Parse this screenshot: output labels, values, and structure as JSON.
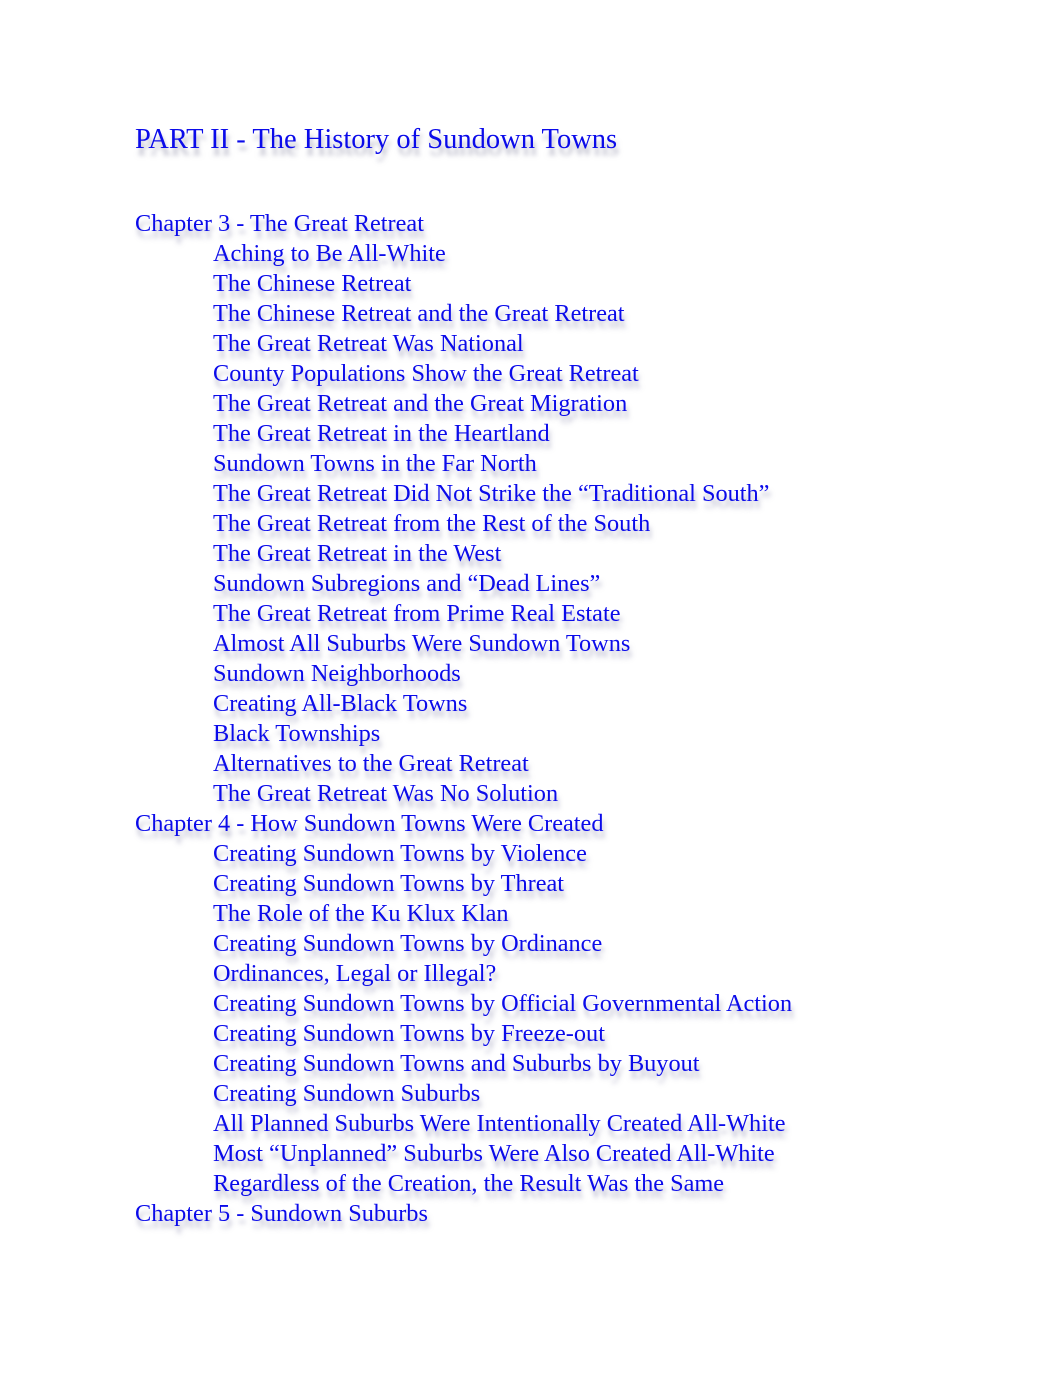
{
  "document": {
    "part_title": "PART II - The History of Sundown Towns",
    "text_color": "#0b0bea",
    "chapters": [
      {
        "title": "Chapter 3 - The Great Retreat",
        "sections": [
          "Aching to Be All-White",
          "The Chinese Retreat",
          "The Chinese Retreat and the Great Retreat",
          "The Great Retreat Was National",
          "County Populations Show the Great Retreat",
          "The Great Retreat and the Great Migration",
          "The Great Retreat in the Heartland",
          "Sundown Towns in the Far North",
          "The Great Retreat Did Not Strike the “Traditional South”",
          "The Great Retreat from the Rest of the South",
          "The Great Retreat in the West",
          "Sundown Subregions and “Dead Lines”",
          "The Great Retreat from Prime Real Estate",
          "Almost All Suburbs Were Sundown Towns",
          "Sundown Neighborhoods",
          "Creating All-Black Towns",
          "Black Townships",
          "Alternatives to the Great Retreat",
          "The Great Retreat Was No Solution"
        ]
      },
      {
        "title": "Chapter 4 - How Sundown Towns Were Created",
        "sections": [
          "Creating Sundown Towns by Violence",
          "Creating Sundown Towns by Threat",
          "The Role of the Ku Klux Klan",
          "Creating Sundown Towns by Ordinance",
          "Ordinances, Legal or Illegal?",
          "Creating Sundown Towns by Official Governmental Action",
          "Creating Sundown Towns by Freeze-out",
          "Creating Sundown Towns and Suburbs by Buyout",
          "Creating Sundown Suburbs",
          "All Planned Suburbs Were Intentionally Created All-White",
          "Most “Unplanned” Suburbs Were Also Created All-White",
          "Regardless of the Creation, the Result Was the Same"
        ]
      },
      {
        "title": "Chapter 5 - Sundown Suburbs",
        "sections": []
      }
    ]
  }
}
